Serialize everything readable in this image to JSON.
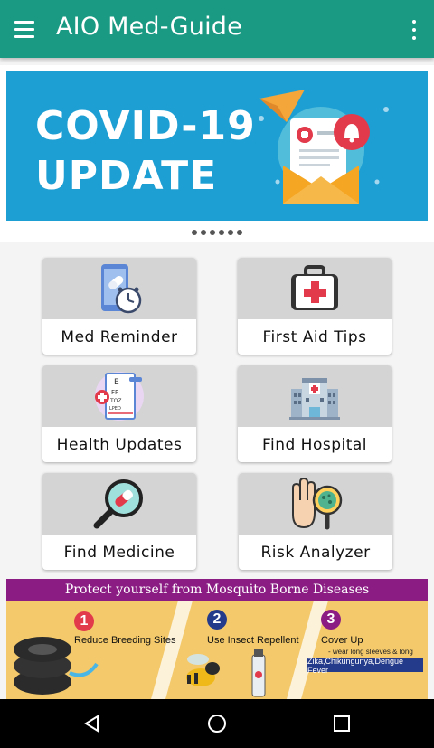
{
  "app": {
    "title": "AIO Med-Guide"
  },
  "appbar": {
    "menu_icon": "hamburger-menu-icon",
    "overflow_icon": "more-vert-icon"
  },
  "carousel": {
    "slide": {
      "line1": "COVID-19",
      "line2": "UPDATE",
      "art_icon": "mail-notification-icon",
      "bg": "#1e9fd4"
    },
    "indicator_count": 6
  },
  "menu": {
    "items": [
      {
        "label": "Med Reminder",
        "icon": "phone-pill-clock-icon"
      },
      {
        "label": "First Aid Tips",
        "icon": "first-aid-kit-icon"
      },
      {
        "label": "Health Updates",
        "icon": "eye-chart-icon"
      },
      {
        "label": "Find Hospital",
        "icon": "hospital-building-icon"
      },
      {
        "label": "Find Medicine",
        "icon": "magnifier-pill-icon"
      },
      {
        "label": "Risk Analyzer",
        "icon": "hand-virus-magnifier-icon"
      }
    ]
  },
  "banner": {
    "title": "Protect yourself from Mosquito Borne Diseases",
    "steps": [
      {
        "num": "1",
        "text": "Reduce Breeding Sites",
        "color": "#e23a4b"
      },
      {
        "num": "2",
        "text": "Use Insect Repellent",
        "color": "#243a8a"
      },
      {
        "num": "3",
        "text": "Cover Up",
        "sub": "- wear long sleeves & long pants",
        "color": "#8a1c83"
      }
    ],
    "tag": "Zika,Chikungunya,Dengue Fever"
  },
  "navbar": {
    "back_icon": "back-triangle-icon",
    "home_icon": "home-circle-icon",
    "recents_icon": "recents-square-icon"
  },
  "colors": {
    "primary": "#1a9a82",
    "tile_top": "#d4d4d4",
    "banner_header": "#8a1c83",
    "banner_bg": "#f3c96b"
  }
}
